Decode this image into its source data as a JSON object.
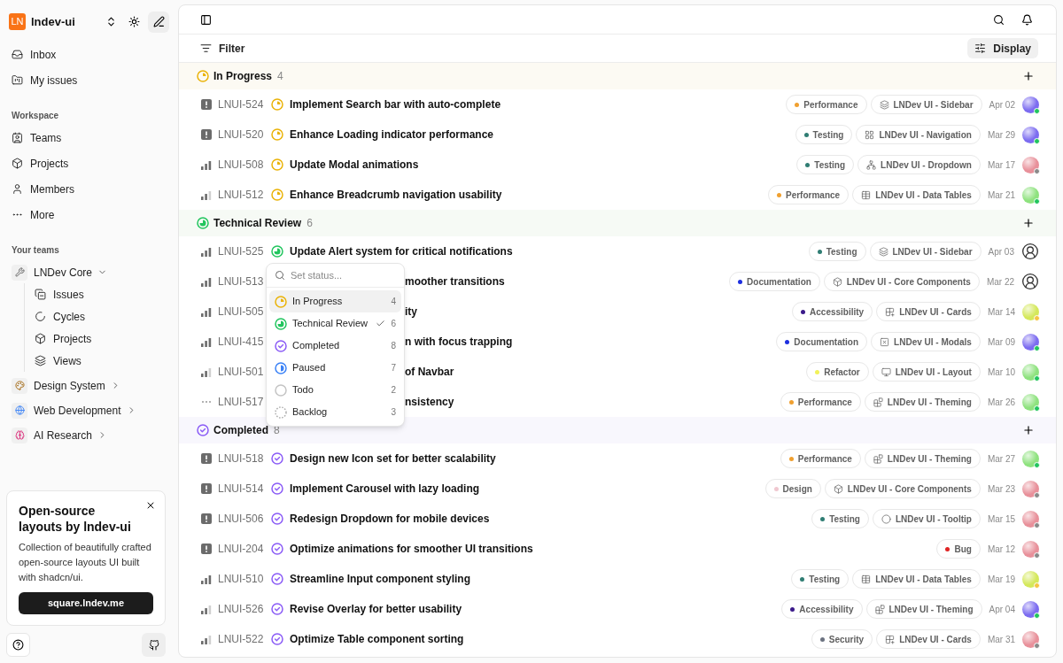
{
  "sidebar": {
    "workspace": {
      "logo": "LN",
      "name": "lndev-ui"
    },
    "nav": [
      {
        "kind": "inbox",
        "label": "Inbox"
      },
      {
        "kind": "issues",
        "label": "My issues"
      }
    ],
    "workspace_section": {
      "title": "Workspace",
      "items": [
        {
          "kind": "teams",
          "label": "Teams"
        },
        {
          "kind": "projects",
          "label": "Projects"
        },
        {
          "kind": "members",
          "label": "Members"
        },
        {
          "kind": "more",
          "label": "More"
        }
      ]
    },
    "teams_section": {
      "title": "Your teams",
      "teams": [
        {
          "kind": "tools",
          "label": "LNDev Core",
          "expanded": true,
          "children": [
            {
              "kind": "issues",
              "label": "Issues"
            },
            {
              "kind": "cycles",
              "label": "Cycles"
            },
            {
              "kind": "projects",
              "label": "Projects"
            },
            {
              "kind": "views",
              "label": "Views"
            }
          ]
        },
        {
          "kind": "palette",
          "label": "Design System",
          "expanded": false
        },
        {
          "kind": "globe",
          "label": "Web Development",
          "expanded": false
        },
        {
          "kind": "brain",
          "label": "AI Research",
          "expanded": false
        }
      ]
    },
    "promo": {
      "title": "Open-source layouts by lndev-ui",
      "body": "Collection of beautifully crafted open-source layouts UI built with shadcn/ui.",
      "button": "square.lndev.me"
    }
  },
  "toolbar": {
    "filter": "Filter",
    "display": "Display"
  },
  "groups": [
    {
      "kind": "in_progress",
      "label": "In Progress",
      "count": "4",
      "issues": [
        {
          "priority": {
            "kind": "urgent"
          },
          "id": "LNUI-524",
          "title": "Implement Search bar with auto-complete",
          "labels": [
            {
              "name": "Performance",
              "color": "#f0a030"
            }
          ],
          "project": {
            "kind": "stack",
            "name": "LNDev UI - Sidebar"
          },
          "date": "Apr 02",
          "assignee": {
            "color": "#7c6cf0",
            "presence": {
              "color": "#22c55e"
            }
          }
        },
        {
          "priority": {
            "kind": "urgent"
          },
          "id": "LNUI-520",
          "title": "Enhance Loading indicator performance",
          "labels": [
            {
              "name": "Testing",
              "color": "#2f7d73"
            }
          ],
          "project": {
            "kind": "grid",
            "name": "LNDev UI - Navigation"
          },
          "date": "Mar 29",
          "assignee": {
            "color": "#7c6cf0",
            "presence": {
              "color": "#22c55e"
            }
          }
        },
        {
          "priority": {
            "kind": "high"
          },
          "id": "LNUI-508",
          "title": "Update Modal animations",
          "labels": [
            {
              "name": "Testing",
              "color": "#2f7d73"
            }
          ],
          "project": {
            "kind": "nodes",
            "name": "LNDev UI - Dropdown"
          },
          "date": "Mar 17",
          "assignee": {
            "color": "#e8909a",
            "presence": {
              "color": "#8a8a8a"
            }
          }
        },
        {
          "priority": {
            "kind": "medium"
          },
          "id": "LNUI-512",
          "title": "Enhance Breadcrumb navigation usability",
          "labels": [
            {
              "name": "Performance",
              "color": "#f0a030"
            }
          ],
          "project": {
            "kind": "table",
            "name": "LNDev UI - Data Tables"
          },
          "date": "Mar 21",
          "assignee": {
            "color": "#8ee27e",
            "presence": {
              "color": "#22c55e"
            }
          }
        }
      ]
    },
    {
      "kind": "technical_review",
      "label": "Technical Review",
      "count": "6",
      "issues": [
        {
          "priority": {
            "kind": "high"
          },
          "id": "LNUI-525",
          "title": "Update Alert system for critical notifications",
          "labels": [
            {
              "name": "Testing",
              "color": "#2f7d73"
            }
          ],
          "project": {
            "kind": "stack",
            "name": "LNDev UI - Sidebar"
          },
          "date": "Apr 03"
        },
        {
          "priority": {
            "kind": "high"
          },
          "id": "LNUI-513",
          "covered": true,
          "title": "moother transitions",
          "labels": [
            {
              "name": "Documentation",
              "color": "#1d2fe0"
            }
          ],
          "project": {
            "kind": "cube",
            "name": "LNDev UI - Core Components"
          },
          "date": "Mar 22"
        },
        {
          "priority": {
            "kind": "high"
          },
          "id": "LNUI-505",
          "covered": true,
          "title": "ity",
          "labels": [
            {
              "name": "Accessibility",
              "color": "#3b1a8a"
            }
          ],
          "project": {
            "kind": "grid-plus",
            "name": "LNDev UI - Cards"
          },
          "date": "Mar 14",
          "assignee": {
            "color": "#d4e85a",
            "presence": {
              "color": "#f5c542"
            }
          }
        },
        {
          "priority": {
            "kind": "high"
          },
          "id": "LNUI-415",
          "covered": true,
          "title": "n with focus trapping",
          "labels": [
            {
              "name": "Documentation",
              "color": "#1d2fe0"
            }
          ],
          "project": {
            "kind": "x-box",
            "name": "LNDev UI - Modals"
          },
          "date": "Mar 09",
          "assignee": {
            "color": "#7c6cf0",
            "presence": {
              "color": "#22c55e"
            }
          }
        },
        {
          "priority": {
            "kind": "medium"
          },
          "id": "LNUI-501",
          "covered": true,
          "title": "of Navbar",
          "labels": [
            {
              "name": "Refactor",
              "color": "#f2f25a"
            }
          ],
          "project": {
            "kind": "monitor",
            "name": "LNDev UI - Layout"
          },
          "date": "Mar 10",
          "assignee": {
            "color": "#8ee27e",
            "presence": {
              "color": "#22c55e"
            }
          }
        },
        {
          "priority": {
            "kind": "none"
          },
          "id": "LNUI-517",
          "covered": true,
          "title": "nsistency",
          "labels": [
            {
              "name": "Performance",
              "color": "#f0a030"
            }
          ],
          "project": {
            "kind": "blocks",
            "name": "LNDev UI - Theming"
          },
          "date": "Mar 26",
          "assignee": {
            "color": "#8ee27e",
            "presence": {
              "color": "#22c55e"
            }
          }
        }
      ]
    },
    {
      "kind": "completed",
      "label": "Completed",
      "count": "8",
      "issues": [
        {
          "priority": {
            "kind": "urgent"
          },
          "id": "LNUI-518",
          "title": "Design new Icon set for better scalability",
          "labels": [
            {
              "name": "Performance",
              "color": "#f0a030"
            }
          ],
          "project": {
            "kind": "blocks",
            "name": "LNDev UI - Theming"
          },
          "date": "Mar 27",
          "assignee": {
            "color": "#8ee27e",
            "presence": {
              "color": "#22c55e"
            }
          }
        },
        {
          "priority": {
            "kind": "urgent"
          },
          "id": "LNUI-514",
          "title": "Implement Carousel with lazy loading",
          "labels": [
            {
              "name": "Design",
              "color": "#f0c8d0"
            }
          ],
          "project": {
            "kind": "cube",
            "name": "LNDev UI - Core Components"
          },
          "date": "Mar 23",
          "assignee": {
            "color": "#e8909a",
            "presence": {
              "color": "#8a8a8a"
            }
          }
        },
        {
          "priority": {
            "kind": "urgent"
          },
          "id": "LNUI-506",
          "title": "Redesign Dropdown for mobile devices",
          "labels": [
            {
              "name": "Testing",
              "color": "#2f7d73"
            }
          ],
          "project": {
            "kind": "circle",
            "name": "LNDev UI - Tooltip"
          },
          "date": "Mar 15",
          "assignee": {
            "color": "#e8909a",
            "presence": {
              "color": "#8a8a8a"
            }
          }
        },
        {
          "priority": {
            "kind": "urgent"
          },
          "id": "LNUI-204",
          "title": "Optimize animations for smoother UI transitions",
          "labels": [
            {
              "name": "Bug",
              "color": "#e02424"
            }
          ],
          "date": "Mar 12",
          "assignee": {
            "color": "#e8909a",
            "presence": {
              "color": "#8a8a8a"
            }
          }
        },
        {
          "priority": {
            "kind": "high"
          },
          "id": "LNUI-510",
          "title": "Streamline Input component styling",
          "labels": [
            {
              "name": "Testing",
              "color": "#2f7d73"
            }
          ],
          "project": {
            "kind": "table",
            "name": "LNDev UI - Data Tables"
          },
          "date": "Mar 19",
          "assignee": {
            "color": "#d4e85a",
            "presence": {
              "color": "#f5c542"
            }
          }
        },
        {
          "priority": {
            "kind": "medium"
          },
          "id": "LNUI-526",
          "title": "Revise Overlay for better usability",
          "labels": [
            {
              "name": "Accessibility",
              "color": "#3b1a8a"
            }
          ],
          "project": {
            "kind": "blocks",
            "name": "LNDev UI - Theming"
          },
          "date": "Apr 04",
          "assignee": {
            "color": "#7c6cf0",
            "presence": {
              "color": "#22c55e"
            }
          }
        },
        {
          "priority": {
            "kind": "medium"
          },
          "id": "LNUI-522",
          "title": "Optimize Table component sorting",
          "labels": [
            {
              "name": "Security",
              "color": "#6b7280"
            }
          ],
          "project": {
            "kind": "grid-plus",
            "name": "LNDev UI - Cards"
          },
          "date": "Mar 31",
          "assignee": {
            "color": "#e8909a",
            "presence": {
              "color": "#8a8a8a"
            }
          }
        }
      ]
    }
  ],
  "status_menu": {
    "placeholder": "Set status...",
    "options": [
      {
        "kind": "in_progress",
        "label": "In Progress",
        "count": "4",
        "selected": true,
        "checked": false
      },
      {
        "kind": "technical_review",
        "label": "Technical Review",
        "count": "6",
        "selected": false,
        "checked": true
      },
      {
        "kind": "completed",
        "label": "Completed",
        "count": "8",
        "selected": false,
        "checked": false
      },
      {
        "kind": "paused",
        "label": "Paused",
        "count": "7",
        "selected": false,
        "checked": false
      },
      {
        "kind": "todo",
        "label": "Todo",
        "count": "2",
        "selected": false,
        "checked": false
      },
      {
        "kind": "backlog",
        "label": "Backlog",
        "count": "3",
        "selected": false,
        "checked": false
      }
    ]
  }
}
